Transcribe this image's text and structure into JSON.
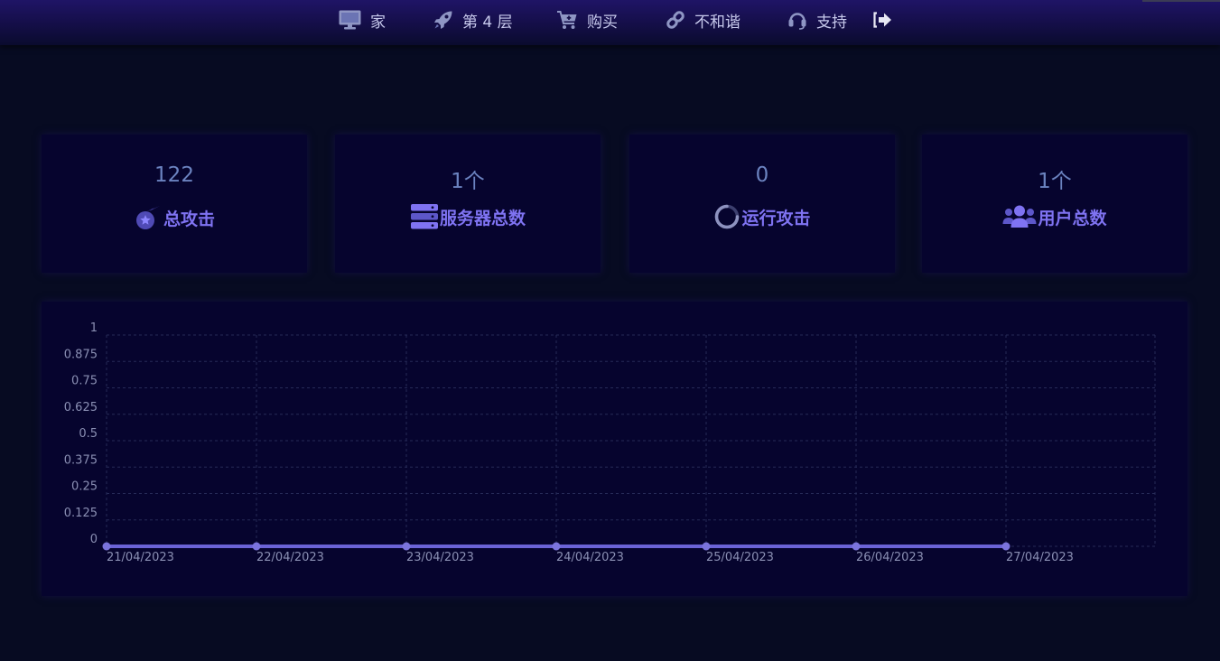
{
  "nav": {
    "items": [
      {
        "label": "家",
        "icon": "monitor-icon"
      },
      {
        "label": "第 4 层",
        "icon": "rocket-icon"
      },
      {
        "label": "购买",
        "icon": "cart-plus-icon"
      },
      {
        "label": "不和谐",
        "icon": "link-icon"
      },
      {
        "label": "支持",
        "icon": "headset-icon"
      }
    ],
    "logout_icon": "sign-out-icon"
  },
  "stats": [
    {
      "value": "122",
      "label": "总攻击",
      "icon": "meteor-icon"
    },
    {
      "value": "1个",
      "label": "服务器总数",
      "icon": "server-icon"
    },
    {
      "value": "0",
      "label": "运行攻击",
      "icon": "spinner-icon"
    },
    {
      "value": "1个",
      "label": "用户总数",
      "icon": "users-icon"
    }
  ],
  "colors": {
    "background": "#070b22",
    "card": "#06042e",
    "accent": "#7f73f2",
    "value": "#6b83c0",
    "series": "#6b63d6"
  },
  "chart_data": {
    "type": "line",
    "x": [
      "21/04/2023",
      "22/04/2023",
      "23/04/2023",
      "24/04/2023",
      "25/04/2023",
      "26/04/2023",
      "27/04/2023"
    ],
    "series": [
      {
        "values": [
          0,
          0,
          0,
          0,
          0,
          0,
          0
        ]
      }
    ],
    "y_ticks": [
      "0",
      "0.125",
      "0.25",
      "0.375",
      "0.5",
      "0.625",
      "0.75",
      "0.875",
      "1"
    ],
    "ylim": [
      0,
      1
    ],
    "grid": true,
    "grid_style": "dashed",
    "legend": false
  }
}
